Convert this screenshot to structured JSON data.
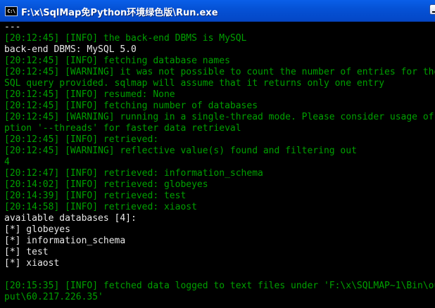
{
  "window": {
    "icon_text": "C:\\",
    "title": "F:\\x\\SqlMap免Python环境绿色版\\Run.exe"
  },
  "console": {
    "lines": [
      {
        "text": "---",
        "color": "white"
      },
      {
        "text": "[20:12:45] [INFO] the back-end DBMS is MySQL",
        "color": "green"
      },
      {
        "text": "back-end DBMS: MySQL 5.0",
        "color": "white"
      },
      {
        "text": "[20:12:45] [INFO] fetching database names",
        "color": "green"
      },
      {
        "text": "[20:12:45] [WARNING] it was not possible to count the number of entries for the",
        "color": "green"
      },
      {
        "text": "SQL query provided. sqlmap will assume that it returns only one entry",
        "color": "green"
      },
      {
        "text": "[20:12:45] [INFO] resumed: None",
        "color": "green"
      },
      {
        "text": "[20:12:45] [INFO] fetching number of databases",
        "color": "green"
      },
      {
        "text": "[20:12:45] [WARNING] running in a single-thread mode. Please consider usage of o",
        "color": "green"
      },
      {
        "text": "ption '--threads' for faster data retrieval",
        "color": "green"
      },
      {
        "text": "[20:12:45] [INFO] retrieved:",
        "color": "green"
      },
      {
        "text": "[20:12:45] [WARNING] reflective value(s) found and filtering out",
        "color": "green"
      },
      {
        "text": "4",
        "color": "green"
      },
      {
        "text": "[20:12:47] [INFO] retrieved: information_schema",
        "color": "green"
      },
      {
        "text": "[20:14:02] [INFO] retrieved: globeyes",
        "color": "green"
      },
      {
        "text": "[20:14:39] [INFO] retrieved: test",
        "color": "green"
      },
      {
        "text": "[20:14:58] [INFO] retrieved: xiaost",
        "color": "green"
      },
      {
        "text": "available databases [4]:",
        "color": "white"
      },
      {
        "text": "[*] globeyes",
        "color": "white"
      },
      {
        "text": "[*] information_schema",
        "color": "white"
      },
      {
        "text": "[*] test",
        "color": "white"
      },
      {
        "text": "[*] xiaost",
        "color": "white"
      },
      {
        "text": "",
        "color": "white"
      },
      {
        "text": "[20:15:35] [INFO] fetched data logged to text files under 'F:\\x\\SQLMAP~1\\Bin\\out",
        "color": "green"
      },
      {
        "text": "put\\60.217.226.35'",
        "color": "green"
      }
    ]
  },
  "colors": {
    "titlebar": "#0552d6",
    "console_background": "#000000",
    "log_text": "#00a000",
    "output_text": "#e8e8e8"
  }
}
